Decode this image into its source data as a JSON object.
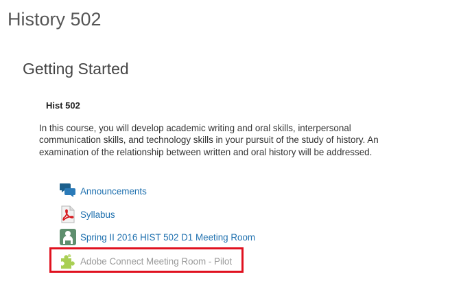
{
  "course": {
    "title": "History 502"
  },
  "section": {
    "title": "Getting Started",
    "subtitle": "Hist 502",
    "description": "In this course, you will develop academic writing and oral skills, interpersonal communication skills, and technology skills in your pursuit of the study of history. An examination of the relationship between written and oral history will be addressed."
  },
  "links": [
    {
      "label": "Announcements",
      "icon": "announcements-icon",
      "color": "#1d6fae"
    },
    {
      "label": "Syllabus",
      "icon": "pdf-icon",
      "color": "#1d6fae"
    },
    {
      "label": "Spring II 2016 HIST 502 D1 Meeting Room",
      "icon": "meeting-room-icon",
      "color": "#1d6fae"
    },
    {
      "label": "Adobe Connect Meeting Room - Pilot",
      "icon": "puzzle-piece-icon",
      "color": "#999999"
    }
  ],
  "highlight": {
    "color": "#e0111f"
  }
}
